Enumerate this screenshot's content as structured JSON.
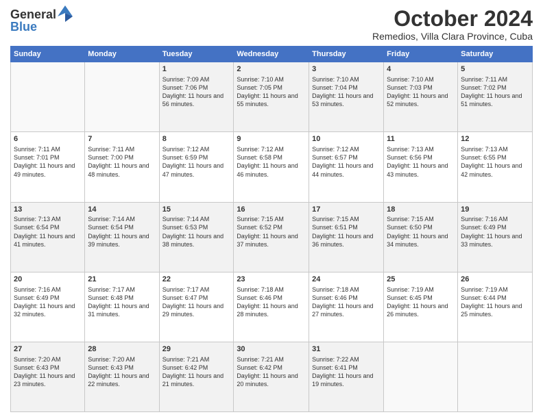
{
  "header": {
    "logo_general": "General",
    "logo_blue": "Blue",
    "month_title": "October 2024",
    "location": "Remedios, Villa Clara Province, Cuba"
  },
  "days_of_week": [
    "Sunday",
    "Monday",
    "Tuesday",
    "Wednesday",
    "Thursday",
    "Friday",
    "Saturday"
  ],
  "weeks": [
    [
      {
        "day": "",
        "sunrise": "",
        "sunset": "",
        "daylight": ""
      },
      {
        "day": "",
        "sunrise": "",
        "sunset": "",
        "daylight": ""
      },
      {
        "day": "1",
        "sunrise": "Sunrise: 7:09 AM",
        "sunset": "Sunset: 7:06 PM",
        "daylight": "Daylight: 11 hours and 56 minutes."
      },
      {
        "day": "2",
        "sunrise": "Sunrise: 7:10 AM",
        "sunset": "Sunset: 7:05 PM",
        "daylight": "Daylight: 11 hours and 55 minutes."
      },
      {
        "day": "3",
        "sunrise": "Sunrise: 7:10 AM",
        "sunset": "Sunset: 7:04 PM",
        "daylight": "Daylight: 11 hours and 53 minutes."
      },
      {
        "day": "4",
        "sunrise": "Sunrise: 7:10 AM",
        "sunset": "Sunset: 7:03 PM",
        "daylight": "Daylight: 11 hours and 52 minutes."
      },
      {
        "day": "5",
        "sunrise": "Sunrise: 7:11 AM",
        "sunset": "Sunset: 7:02 PM",
        "daylight": "Daylight: 11 hours and 51 minutes."
      }
    ],
    [
      {
        "day": "6",
        "sunrise": "Sunrise: 7:11 AM",
        "sunset": "Sunset: 7:01 PM",
        "daylight": "Daylight: 11 hours and 49 minutes."
      },
      {
        "day": "7",
        "sunrise": "Sunrise: 7:11 AM",
        "sunset": "Sunset: 7:00 PM",
        "daylight": "Daylight: 11 hours and 48 minutes."
      },
      {
        "day": "8",
        "sunrise": "Sunrise: 7:12 AM",
        "sunset": "Sunset: 6:59 PM",
        "daylight": "Daylight: 11 hours and 47 minutes."
      },
      {
        "day": "9",
        "sunrise": "Sunrise: 7:12 AM",
        "sunset": "Sunset: 6:58 PM",
        "daylight": "Daylight: 11 hours and 46 minutes."
      },
      {
        "day": "10",
        "sunrise": "Sunrise: 7:12 AM",
        "sunset": "Sunset: 6:57 PM",
        "daylight": "Daylight: 11 hours and 44 minutes."
      },
      {
        "day": "11",
        "sunrise": "Sunrise: 7:13 AM",
        "sunset": "Sunset: 6:56 PM",
        "daylight": "Daylight: 11 hours and 43 minutes."
      },
      {
        "day": "12",
        "sunrise": "Sunrise: 7:13 AM",
        "sunset": "Sunset: 6:55 PM",
        "daylight": "Daylight: 11 hours and 42 minutes."
      }
    ],
    [
      {
        "day": "13",
        "sunrise": "Sunrise: 7:13 AM",
        "sunset": "Sunset: 6:54 PM",
        "daylight": "Daylight: 11 hours and 41 minutes."
      },
      {
        "day": "14",
        "sunrise": "Sunrise: 7:14 AM",
        "sunset": "Sunset: 6:54 PM",
        "daylight": "Daylight: 11 hours and 39 minutes."
      },
      {
        "day": "15",
        "sunrise": "Sunrise: 7:14 AM",
        "sunset": "Sunset: 6:53 PM",
        "daylight": "Daylight: 11 hours and 38 minutes."
      },
      {
        "day": "16",
        "sunrise": "Sunrise: 7:15 AM",
        "sunset": "Sunset: 6:52 PM",
        "daylight": "Daylight: 11 hours and 37 minutes."
      },
      {
        "day": "17",
        "sunrise": "Sunrise: 7:15 AM",
        "sunset": "Sunset: 6:51 PM",
        "daylight": "Daylight: 11 hours and 36 minutes."
      },
      {
        "day": "18",
        "sunrise": "Sunrise: 7:15 AM",
        "sunset": "Sunset: 6:50 PM",
        "daylight": "Daylight: 11 hours and 34 minutes."
      },
      {
        "day": "19",
        "sunrise": "Sunrise: 7:16 AM",
        "sunset": "Sunset: 6:49 PM",
        "daylight": "Daylight: 11 hours and 33 minutes."
      }
    ],
    [
      {
        "day": "20",
        "sunrise": "Sunrise: 7:16 AM",
        "sunset": "Sunset: 6:49 PM",
        "daylight": "Daylight: 11 hours and 32 minutes."
      },
      {
        "day": "21",
        "sunrise": "Sunrise: 7:17 AM",
        "sunset": "Sunset: 6:48 PM",
        "daylight": "Daylight: 11 hours and 31 minutes."
      },
      {
        "day": "22",
        "sunrise": "Sunrise: 7:17 AM",
        "sunset": "Sunset: 6:47 PM",
        "daylight": "Daylight: 11 hours and 29 minutes."
      },
      {
        "day": "23",
        "sunrise": "Sunrise: 7:18 AM",
        "sunset": "Sunset: 6:46 PM",
        "daylight": "Daylight: 11 hours and 28 minutes."
      },
      {
        "day": "24",
        "sunrise": "Sunrise: 7:18 AM",
        "sunset": "Sunset: 6:46 PM",
        "daylight": "Daylight: 11 hours and 27 minutes."
      },
      {
        "day": "25",
        "sunrise": "Sunrise: 7:19 AM",
        "sunset": "Sunset: 6:45 PM",
        "daylight": "Daylight: 11 hours and 26 minutes."
      },
      {
        "day": "26",
        "sunrise": "Sunrise: 7:19 AM",
        "sunset": "Sunset: 6:44 PM",
        "daylight": "Daylight: 11 hours and 25 minutes."
      }
    ],
    [
      {
        "day": "27",
        "sunrise": "Sunrise: 7:20 AM",
        "sunset": "Sunset: 6:43 PM",
        "daylight": "Daylight: 11 hours and 23 minutes."
      },
      {
        "day": "28",
        "sunrise": "Sunrise: 7:20 AM",
        "sunset": "Sunset: 6:43 PM",
        "daylight": "Daylight: 11 hours and 22 minutes."
      },
      {
        "day": "29",
        "sunrise": "Sunrise: 7:21 AM",
        "sunset": "Sunset: 6:42 PM",
        "daylight": "Daylight: 11 hours and 21 minutes."
      },
      {
        "day": "30",
        "sunrise": "Sunrise: 7:21 AM",
        "sunset": "Sunset: 6:42 PM",
        "daylight": "Daylight: 11 hours and 20 minutes."
      },
      {
        "day": "31",
        "sunrise": "Sunrise: 7:22 AM",
        "sunset": "Sunset: 6:41 PM",
        "daylight": "Daylight: 11 hours and 19 minutes."
      },
      {
        "day": "",
        "sunrise": "",
        "sunset": "",
        "daylight": ""
      },
      {
        "day": "",
        "sunrise": "",
        "sunset": "",
        "daylight": ""
      }
    ]
  ]
}
